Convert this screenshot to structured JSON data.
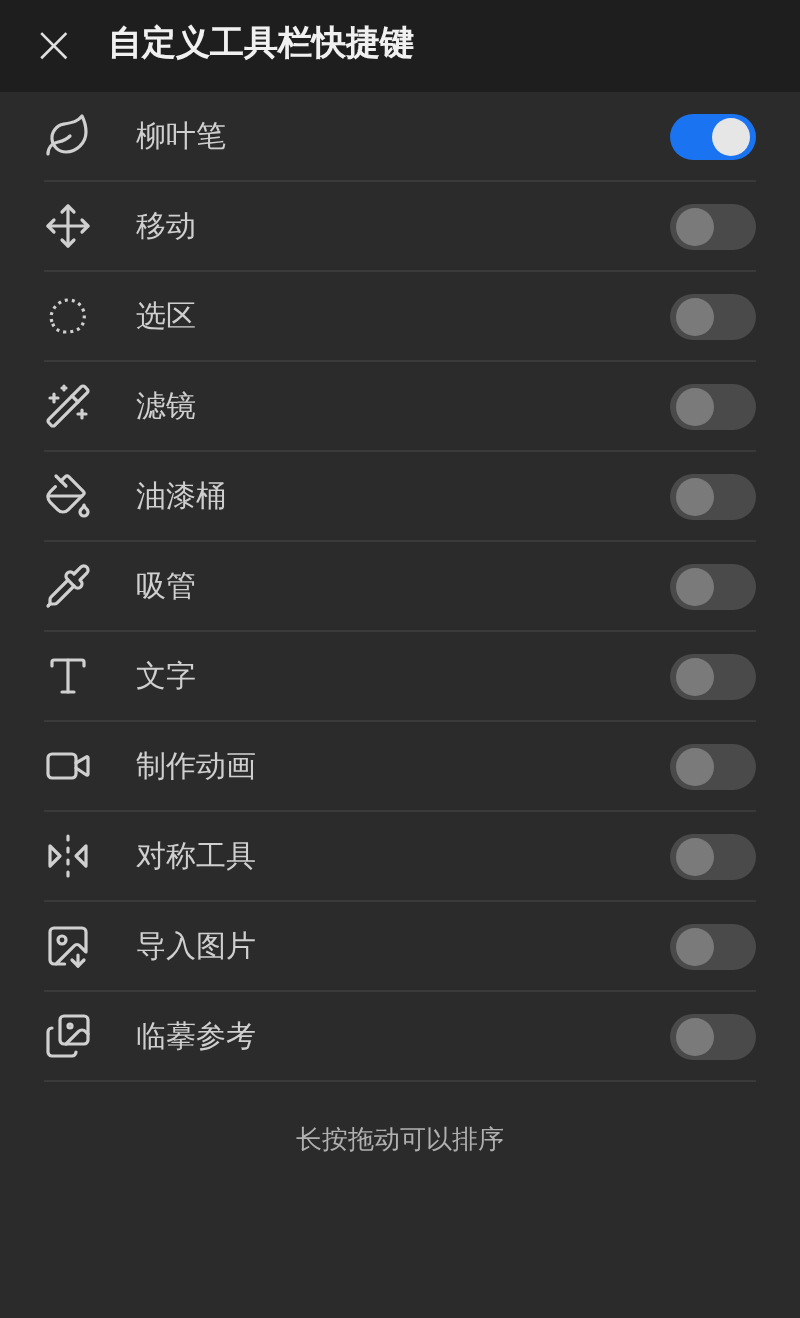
{
  "header": {
    "close_icon": "×",
    "title": "自定义工具栏快捷键"
  },
  "tools": [
    {
      "kind": "brush",
      "label": "柳叶笔",
      "on": true
    },
    {
      "kind": "move",
      "label": "移动",
      "on": false
    },
    {
      "kind": "select",
      "label": "选区",
      "on": false
    },
    {
      "kind": "filter",
      "label": "滤镜",
      "on": false
    },
    {
      "kind": "bucket",
      "label": "油漆桶",
      "on": false
    },
    {
      "kind": "picker",
      "label": "吸管",
      "on": false
    },
    {
      "kind": "text",
      "label": "文字",
      "on": false
    },
    {
      "kind": "animation",
      "label": "制作动画",
      "on": false
    },
    {
      "kind": "symmetry",
      "label": "对称工具",
      "on": false
    },
    {
      "kind": "import",
      "label": "导入图片",
      "on": false
    },
    {
      "kind": "reference",
      "label": "临摹参考",
      "on": false
    }
  ],
  "hint": "长按拖动可以排序"
}
